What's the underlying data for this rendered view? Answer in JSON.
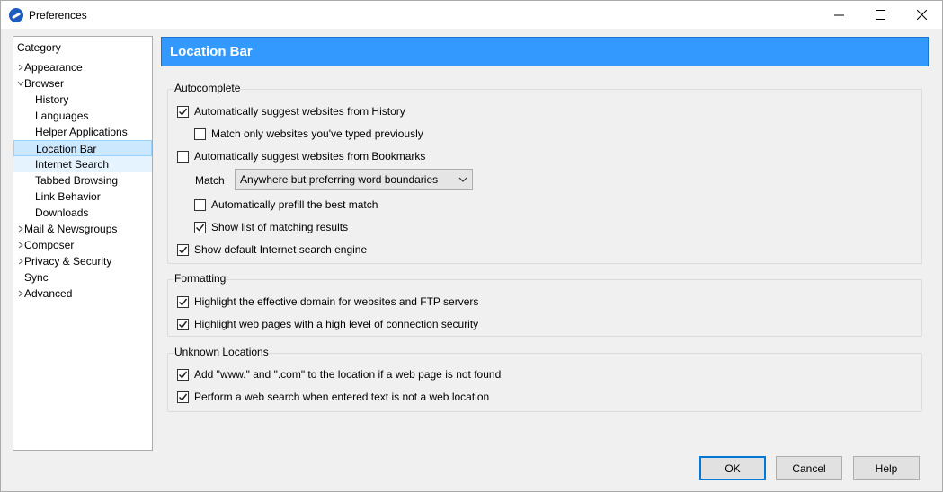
{
  "window": {
    "title": "Preferences",
    "icon": "seamonkey-app-icon"
  },
  "sidebar": {
    "header": "Category",
    "items": [
      {
        "label": "Appearance",
        "level": 0,
        "twisty": "collapsed"
      },
      {
        "label": "Browser",
        "level": 0,
        "twisty": "expanded"
      },
      {
        "label": "History",
        "level": 1
      },
      {
        "label": "Languages",
        "level": 1
      },
      {
        "label": "Helper Applications",
        "level": 1
      },
      {
        "label": "Location Bar",
        "level": 1,
        "state": "selected"
      },
      {
        "label": "Internet Search",
        "level": 1,
        "state": "hover"
      },
      {
        "label": "Tabbed Browsing",
        "level": 1
      },
      {
        "label": "Link Behavior",
        "level": 1
      },
      {
        "label": "Downloads",
        "level": 1
      },
      {
        "label": "Mail & Newsgroups",
        "level": 0,
        "twisty": "collapsed"
      },
      {
        "label": "Composer",
        "level": 0,
        "twisty": "collapsed"
      },
      {
        "label": "Privacy & Security",
        "level": 0,
        "twisty": "collapsed"
      },
      {
        "label": "Sync",
        "level": 0
      },
      {
        "label": "Advanced",
        "level": 0,
        "twisty": "collapsed"
      }
    ]
  },
  "page": {
    "title": "Location Bar",
    "accent": "#3399ff"
  },
  "autocomplete": {
    "title": "Autocomplete",
    "suggest_history": {
      "label": "Automatically suggest websites from History",
      "checked": true
    },
    "match_typed": {
      "label": "Match only websites you've typed previously",
      "checked": false
    },
    "suggest_bookmarks": {
      "label": "Automatically suggest websites from Bookmarks",
      "checked": false
    },
    "match_label": "Match",
    "match_value": "Anywhere but preferring word boundaries",
    "prefill": {
      "label": "Automatically prefill the best match",
      "checked": false
    },
    "show_list": {
      "label": "Show list of matching results",
      "checked": true
    },
    "show_engine": {
      "label": "Show default Internet search engine",
      "checked": true
    }
  },
  "formatting": {
    "title": "Formatting",
    "highlight_domain": {
      "label": "Highlight the effective domain for websites and FTP servers",
      "checked": true
    },
    "highlight_secure": {
      "label": "Highlight web pages with a high level of connection security",
      "checked": true
    }
  },
  "unknown": {
    "title": "Unknown Locations",
    "add_www": {
      "label": "Add \"www.\" and \".com\" to the location if a web page is not found",
      "checked": true
    },
    "web_search": {
      "label": "Perform a web search when entered text is not a web location",
      "checked": true
    }
  },
  "buttons": {
    "ok": "OK",
    "cancel": "Cancel",
    "help": "Help"
  }
}
